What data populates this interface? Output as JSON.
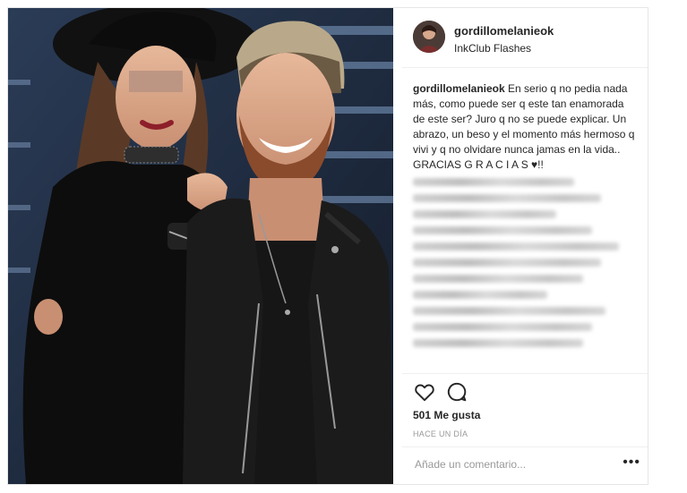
{
  "post": {
    "username": "gordillomelanieok",
    "location": "InkClub Flashes",
    "caption_user": "gordillomelanieok",
    "caption_text": "En serio q no pedia nada más, como puede ser q este tan enamorada de este ser? Juro q no se puede explicar. Un abrazo, un beso y el momento más hermoso q vivi y q no olvidare nunca jamas en la vida.. GRACIAS G R A C I A S ♥!!",
    "likes": "501 Me gusta",
    "timestamp": "HACE UN DÍA",
    "comment_placeholder": "Añade un comentario...",
    "more_label": "•••"
  },
  "icons": {
    "like": "heart-outline-icon",
    "comment": "comment-bubble-icon"
  },
  "colors": {
    "text": "#262626",
    "muted": "#999999",
    "border": "#efefef"
  }
}
